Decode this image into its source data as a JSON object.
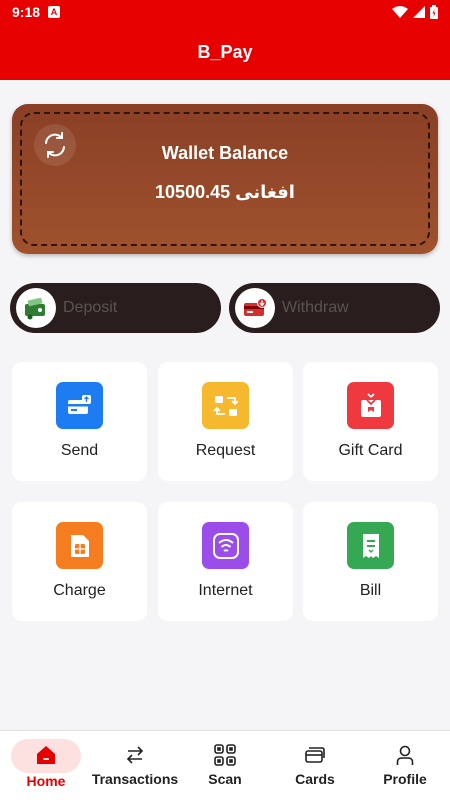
{
  "status_bar": {
    "time": "9:18",
    "notification_icon": "A"
  },
  "app_bar": {
    "title": "B_Pay"
  },
  "wallet": {
    "title": "Wallet Balance",
    "amount": "10500.45 افغانی",
    "refresh_icon": "refresh-icon"
  },
  "actions": {
    "deposit": {
      "label": "Deposit",
      "icon": "wallet-cash-icon"
    },
    "withdraw": {
      "label": "Withdraw",
      "icon": "card-withdraw-icon"
    }
  },
  "services": [
    {
      "label": "Send",
      "icon": "send-card-icon",
      "color": "#1e7cf2"
    },
    {
      "label": "Request",
      "icon": "request-arrows-icon",
      "color": "#f5b82e"
    },
    {
      "label": "Gift Card",
      "icon": "gift-icon",
      "color": "#f0383f"
    },
    {
      "label": "Charge",
      "icon": "sim-card-icon",
      "color": "#f57c1f"
    },
    {
      "label": "Internet",
      "icon": "wifi-icon",
      "color": "#9b4dea"
    },
    {
      "label": "Bill",
      "icon": "receipt-icon",
      "color": "#34a853"
    }
  ],
  "bottom_nav": {
    "items": [
      {
        "label": "Home",
        "icon": "home-icon",
        "active": true
      },
      {
        "label": "Transactions",
        "icon": "swap-arrows-icon"
      },
      {
        "label": "Scan",
        "icon": "qr-scan-icon"
      },
      {
        "label": "Cards",
        "icon": "cards-icon"
      },
      {
        "label": "Profile",
        "icon": "user-icon"
      }
    ]
  },
  "colors": {
    "primary": "#e60000",
    "wallet": "#a0522d",
    "pill_bg": "#2a1d1d"
  }
}
